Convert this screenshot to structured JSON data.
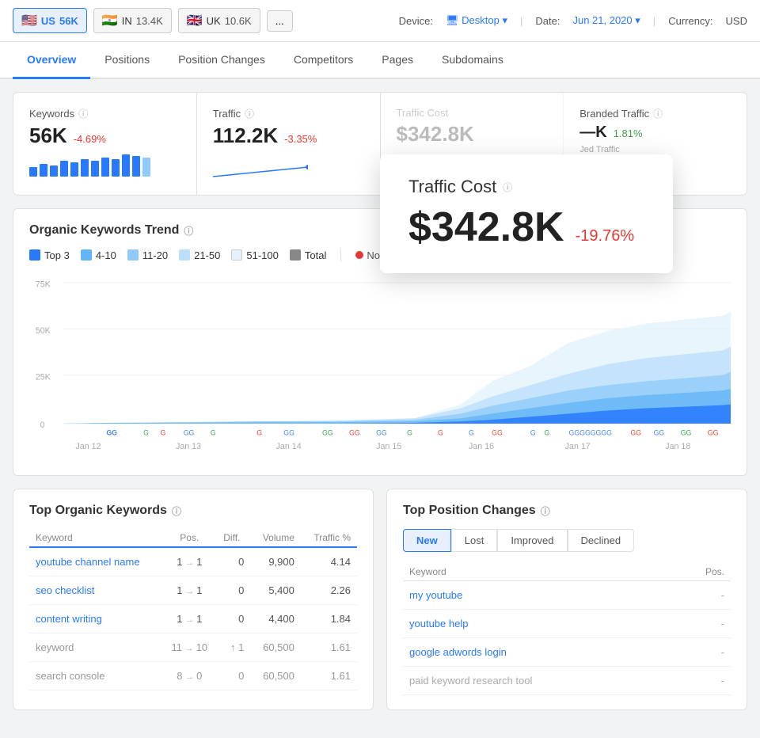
{
  "topbar": {
    "countries": [
      {
        "id": "us",
        "flag": "🇺🇸",
        "code": "US",
        "count": "56K",
        "active": true
      },
      {
        "id": "in",
        "flag": "🇮🇳",
        "code": "IN",
        "count": "13.4K",
        "active": false
      },
      {
        "id": "uk",
        "flag": "🇬🇧",
        "code": "UK",
        "count": "10.6K",
        "active": false
      }
    ],
    "more_label": "...",
    "device_label": "Device:",
    "device_value": "Desktop",
    "date_label": "Date:",
    "date_value": "Jun 21, 2020",
    "currency_label": "Currency:",
    "currency_value": "USD"
  },
  "nav": {
    "tabs": [
      {
        "id": "overview",
        "label": "Overview",
        "active": true
      },
      {
        "id": "positions",
        "label": "Positions",
        "active": false
      },
      {
        "id": "position-changes",
        "label": "Position Changes",
        "active": false
      },
      {
        "id": "competitors",
        "label": "Competitors",
        "active": false
      },
      {
        "id": "pages",
        "label": "Pages",
        "active": false
      },
      {
        "id": "subdomains",
        "label": "Subdomains",
        "active": false
      }
    ]
  },
  "stats": {
    "keywords": {
      "label": "Keywords",
      "value": "56K",
      "change": "-4.69%",
      "change_type": "neg"
    },
    "traffic": {
      "label": "Traffic",
      "value": "112.2K",
      "change": "-3.35%",
      "change_type": "neg"
    },
    "branded_traffic": {
      "label": "Branded Traffic",
      "partial": "ded Traffic"
    },
    "change_value": "1.81%",
    "jed_traffic": "Jed Traffic"
  },
  "traffic_cost_popup": {
    "label": "Traffic Cost",
    "value": "$342.8K",
    "change": "-19.76%"
  },
  "trend": {
    "title": "Organic Keywords Trend",
    "legend": [
      {
        "label": "Top 3",
        "color": "#4285f4",
        "checked": true
      },
      {
        "label": "4-10",
        "color": "#7bbbf5",
        "checked": true
      },
      {
        "label": "11-20",
        "color": "#a8d5f7",
        "checked": true
      },
      {
        "label": "21-50",
        "color": "#cce8fb",
        "checked": true
      },
      {
        "label": "51-100",
        "color": "#e8f5fe",
        "checked": true
      },
      {
        "label": "Total",
        "color": "#888",
        "checked": true
      }
    ],
    "notes_label": "Notes",
    "y_labels": [
      "75K",
      "50K",
      "25K",
      "0"
    ],
    "x_labels": [
      "Jan 12",
      "Jan 13",
      "Jan 14",
      "Jan 15",
      "Jan 16",
      "Jan 17",
      "Jan 18"
    ]
  },
  "top_keywords": {
    "title": "Top Organic Keywords",
    "columns": [
      "Keyword",
      "Pos.",
      "Diff.",
      "Volume",
      "Traffic %"
    ],
    "rows": [
      {
        "keyword": "youtube channel name",
        "pos": "1",
        "arrow": "→",
        "diff": "1",
        "volume_diff": "0",
        "volume": "9,900",
        "traffic": "4.14",
        "link": true
      },
      {
        "keyword": "seo checklist",
        "pos": "1",
        "arrow": "→",
        "diff": "1",
        "volume_diff": "0",
        "volume": "5,400",
        "traffic": "2.26",
        "link": true
      },
      {
        "keyword": "content writing",
        "pos": "1",
        "arrow": "→",
        "diff": "1",
        "volume_diff": "0",
        "volume": "4,400",
        "traffic": "1.84",
        "link": true
      },
      {
        "keyword": "keyword",
        "pos": "11",
        "arrow": "→",
        "diff": "10",
        "volume_diff": "↑ 1",
        "volume": "60,500",
        "traffic": "1.61",
        "link": false
      },
      {
        "keyword": "search console",
        "pos": "8",
        "arrow": "→",
        "diff": "0",
        "volume_diff": "0",
        "volume": "60,500",
        "traffic": "1.61",
        "link": false
      }
    ]
  },
  "top_position_changes": {
    "title": "Top Position Changes",
    "tabs": [
      {
        "label": "New",
        "active": true
      },
      {
        "label": "Lost",
        "active": false
      },
      {
        "label": "Improved",
        "active": false
      },
      {
        "label": "Declined",
        "active": false
      }
    ],
    "columns": [
      "Keyword",
      "Pos."
    ],
    "rows": [
      {
        "keyword": "my youtube",
        "pos": "-",
        "link": true
      },
      {
        "keyword": "youtube help",
        "pos": "-",
        "link": true
      },
      {
        "keyword": "google adwords login",
        "pos": "-",
        "link": true
      },
      {
        "keyword": "paid keyword research tool",
        "pos": "-",
        "link": false
      }
    ]
  }
}
